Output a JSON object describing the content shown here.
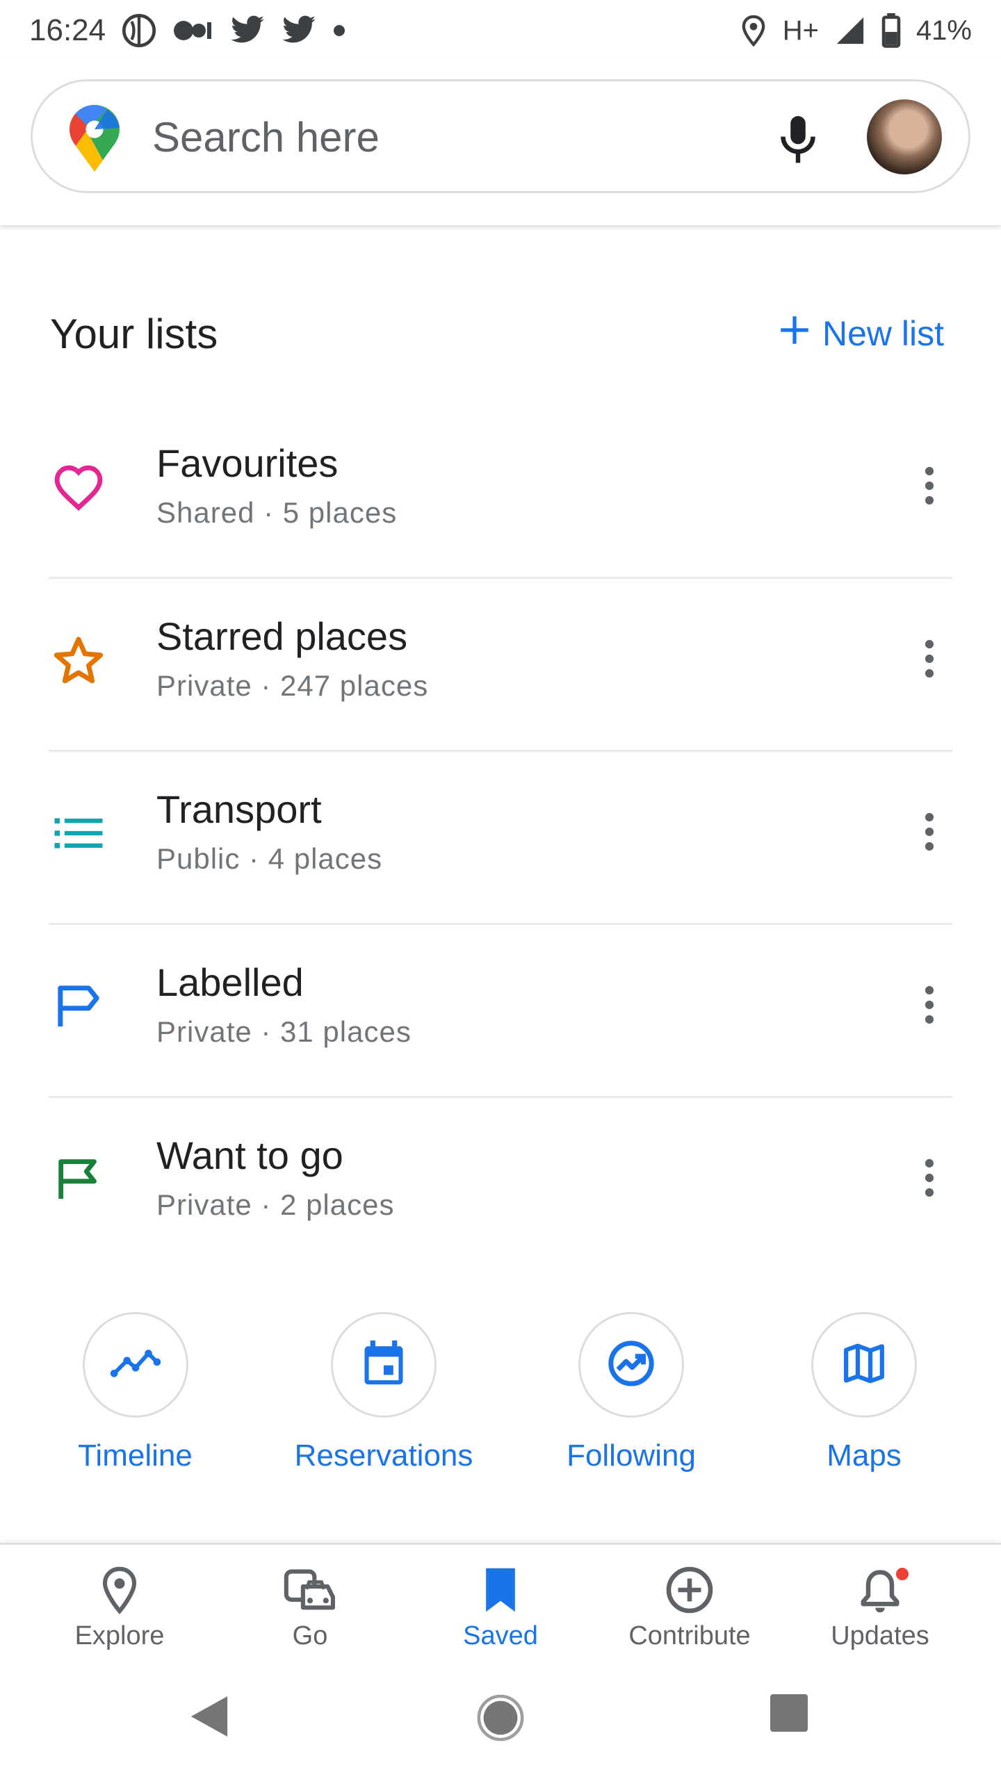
{
  "status_bar": {
    "time": "16:24",
    "network": "H+",
    "battery": "41%"
  },
  "search": {
    "placeholder": "Search here"
  },
  "lists_section": {
    "title": "Your lists",
    "new_list_label": "New list"
  },
  "lists": [
    {
      "title": "Favourites",
      "subtitle": "Shared · 5 places",
      "icon": "heart-icon",
      "color": "#e52592"
    },
    {
      "title": "Starred places",
      "subtitle": "Private · 247 places",
      "icon": "star-icon",
      "color": "#e37400"
    },
    {
      "title": "Transport",
      "subtitle": "Public · 4 places",
      "icon": "list-icon",
      "color": "#12a4af"
    },
    {
      "title": "Labelled",
      "subtitle": "Private · 31 places",
      "icon": "label-flag-icon",
      "color": "#1a73e8"
    },
    {
      "title": "Want to go",
      "subtitle": "Private · 2 places",
      "icon": "flag-icon",
      "color": "#188038"
    }
  ],
  "shortcuts": [
    {
      "label": "Timeline",
      "icon": "timeline-icon"
    },
    {
      "label": "Reservations",
      "icon": "calendar-icon"
    },
    {
      "label": "Following",
      "icon": "trending-icon"
    },
    {
      "label": "Maps",
      "icon": "map-icon"
    }
  ],
  "bottom_nav": [
    {
      "label": "Explore",
      "icon": "location-pin-icon",
      "active": false
    },
    {
      "label": "Go",
      "icon": "commute-icon",
      "active": false
    },
    {
      "label": "Saved",
      "icon": "bookmark-icon",
      "active": true
    },
    {
      "label": "Contribute",
      "icon": "add-circle-icon",
      "active": false
    },
    {
      "label": "Updates",
      "icon": "bell-icon",
      "active": false
    }
  ],
  "colors": {
    "accent": "#1a73e8",
    "text_primary": "#202124",
    "text_secondary": "#70757a",
    "divider": "#e8eaed",
    "notification": "#ea4335"
  }
}
